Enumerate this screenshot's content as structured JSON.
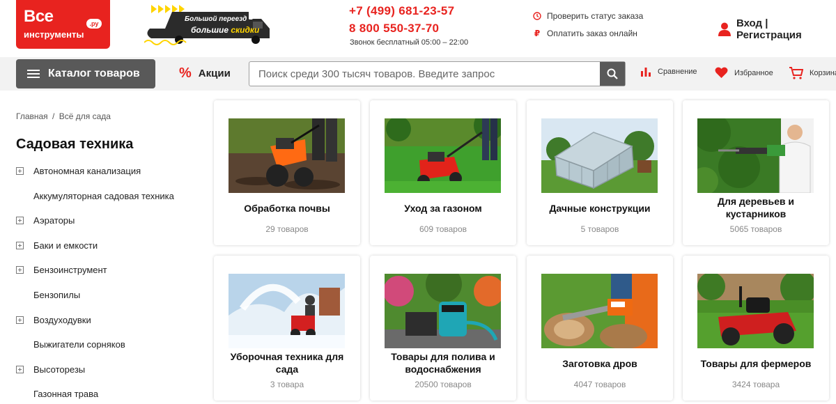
{
  "header": {
    "logo_line1": "Все",
    "logo_line2": "инструменты",
    "logo_ru": ".ру",
    "promo_line1": "Большой переезд –",
    "promo_line2_a": "большие ",
    "promo_line2_b": "скидки",
    "phone_primary": "+7 (499) 681-23-57",
    "phone_secondary": "8 800 550-37-70",
    "phone_note": "Звонок бесплатный 05:00 – 22:00",
    "link_order_status": "Проверить статус заказа",
    "link_pay_online": "Оплатить заказ онлайн",
    "login_label": "Вход | Регистрация"
  },
  "navbar": {
    "catalog_label": "Каталог товаров",
    "promo_label": "Акции",
    "search_placeholder": "Поиск среди 300 тысяч товаров. Введите запрос",
    "compare_label": "Сравнение",
    "favorites_label": "Избранное",
    "cart_label": "Корзина"
  },
  "breadcrumb": {
    "home": "Главная",
    "separator": "/",
    "current": "Всё для сада"
  },
  "sidebar": {
    "title": "Садовая техника",
    "items": [
      {
        "label": "Автономная канализация",
        "expandable": true
      },
      {
        "label": "Аккумуляторная садовая техника",
        "expandable": false
      },
      {
        "label": "Аэраторы",
        "expandable": true
      },
      {
        "label": "Баки и емкости",
        "expandable": true
      },
      {
        "label": "Бензоинструмент",
        "expandable": true
      },
      {
        "label": "Бензопилы",
        "expandable": false
      },
      {
        "label": "Воздуходувки",
        "expandable": true
      },
      {
        "label": "Выжигатели сорняков",
        "expandable": false
      },
      {
        "label": "Высоторезы",
        "expandable": true
      },
      {
        "label": "Газонная трава",
        "expandable": false
      }
    ]
  },
  "categories": [
    {
      "title": "Обработка почвы",
      "count": "29 товаров"
    },
    {
      "title": "Уход за газоном",
      "count": "609 товаров"
    },
    {
      "title": "Дачные конструкции",
      "count": "5 товаров"
    },
    {
      "title": "Для деревьев и кустарников",
      "count": "5065 товаров"
    },
    {
      "title": "Уборочная техника для сада",
      "count": "3 товара"
    },
    {
      "title": "Товары для полива и водоснабжения",
      "count": "20500 товаров"
    },
    {
      "title": "Заготовка дров",
      "count": "4047 товаров"
    },
    {
      "title": "Товары для фермеров",
      "count": "3424 товара"
    }
  ],
  "colors": {
    "brand_red": "#e8231f",
    "catalog_button": "#595959",
    "navbar_bg": "#f2f2f2"
  },
  "icons": [
    "user-icon",
    "clock-icon",
    "ruble-icon",
    "search-icon",
    "compare-icon",
    "heart-icon",
    "cart-icon",
    "percent-icon",
    "menu-icon"
  ]
}
